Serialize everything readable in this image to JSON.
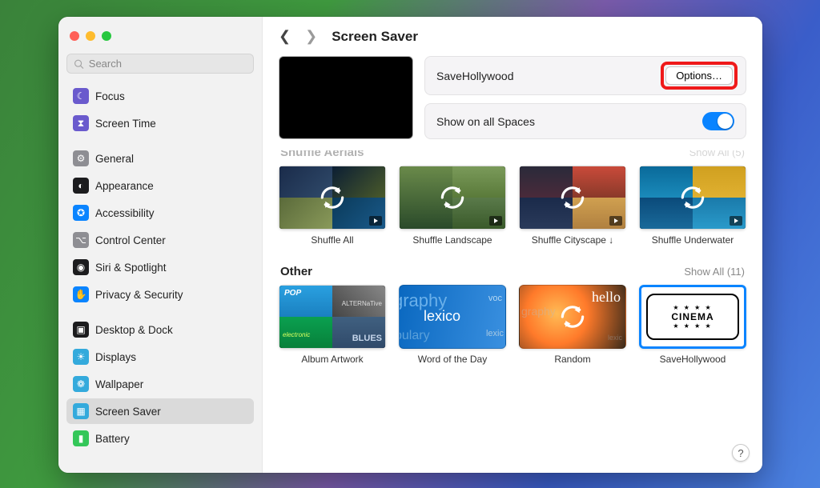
{
  "window": {
    "search_placeholder": "Search",
    "page_title": "Screen Saver"
  },
  "sidebar": {
    "items": [
      {
        "label": "Focus",
        "icon_color": "#6a5acd",
        "icon_glyph": "☾"
      },
      {
        "label": "Screen Time",
        "icon_color": "#6a5acd",
        "icon_glyph": "⧗"
      },
      {
        "label": "General",
        "icon_color": "#8e8e93",
        "icon_glyph": "⚙"
      },
      {
        "label": "Appearance",
        "icon_color": "#1c1c1e",
        "icon_glyph": "◐"
      },
      {
        "label": "Accessibility",
        "icon_color": "#0a84ff",
        "icon_glyph": "✪"
      },
      {
        "label": "Control Center",
        "icon_color": "#8e8e93",
        "icon_glyph": "⌥"
      },
      {
        "label": "Siri & Spotlight",
        "icon_color": "#1c1c1e",
        "icon_glyph": "◉"
      },
      {
        "label": "Privacy & Security",
        "icon_color": "#0a84ff",
        "icon_glyph": "✋"
      },
      {
        "label": "Desktop & Dock",
        "icon_color": "#1c1c1e",
        "icon_glyph": "▣"
      },
      {
        "label": "Displays",
        "icon_color": "#34aadc",
        "icon_glyph": "☀"
      },
      {
        "label": "Wallpaper",
        "icon_color": "#34aadc",
        "icon_glyph": "❁"
      },
      {
        "label": "Screen Saver",
        "icon_color": "#34aadc",
        "icon_glyph": "▦",
        "selected": true
      },
      {
        "label": "Battery",
        "icon_color": "#34c759",
        "icon_glyph": "▮"
      }
    ],
    "gaps_after": [
      1,
      7
    ]
  },
  "main": {
    "selected_saver_name": "SaveHollywood",
    "options_button": "Options…",
    "show_spaces_label": "Show on all Spaces",
    "show_spaces_on": true
  },
  "sections": [
    {
      "title": "Shuffle Aerials",
      "show_all_label": "Show All",
      "show_all_count": 5,
      "faded": true,
      "items": [
        {
          "label": "Shuffle All",
          "kind": "aerial-all",
          "shuffle": true,
          "play": true
        },
        {
          "label": "Shuffle Landscape",
          "kind": "aerial-land",
          "shuffle": true,
          "play": true
        },
        {
          "label": "Shuffle Cityscape ↓",
          "kind": "aerial-city",
          "shuffle": true,
          "play": true
        },
        {
          "label": "Shuffle Underwater",
          "kind": "aerial-water",
          "shuffle": true,
          "play": true
        }
      ]
    },
    {
      "title": "Other",
      "show_all_label": "Show All",
      "show_all_count": 11,
      "items": [
        {
          "label": "Album Artwork",
          "kind": "album"
        },
        {
          "label": "Word of the Day",
          "kind": "word"
        },
        {
          "label": "Random",
          "kind": "random",
          "shuffle": true
        },
        {
          "label": "SaveHollywood",
          "kind": "cinema",
          "selected": true
        }
      ]
    }
  ],
  "decor": {
    "album": {
      "t1": "POP",
      "t2": "ALTERNaTive",
      "t3": "electronic",
      "t4": "BLUES"
    },
    "word": {
      "t1": "graphy",
      "t2": "voc",
      "t3": "lexico",
      "t4": "bulary",
      "t5": "lexic"
    },
    "random": {
      "t1": "hello",
      "t2": "graphy",
      "t3": "lexic"
    },
    "cinema": "CINEMA"
  },
  "help_glyph": "?"
}
